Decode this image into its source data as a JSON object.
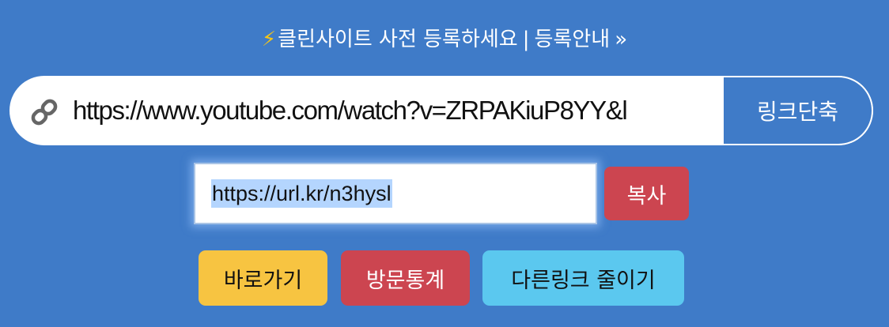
{
  "notice": {
    "bolt": "⚡",
    "main_text": "클린사이트 사전 등록하세요",
    "separator": "|",
    "link_text": "등록안내",
    "raquo": "»"
  },
  "shortener": {
    "input_value": "https://www.youtube.com/watch?v=ZRPAKiuP8YY&l",
    "button_label": "링크단축",
    "icon": "link-icon"
  },
  "result": {
    "short_url": "https://url.kr/n3hysl",
    "copy_label": "복사"
  },
  "actions": {
    "goto_label": "바로가기",
    "stats_label": "방문통계",
    "another_label": "다른링크 줄이기"
  },
  "colors": {
    "background": "#3f7bc8",
    "bolt": "#f5c518",
    "copy_button": "#cc4550",
    "goto_button": "#f7c441",
    "stats_button": "#cc4550",
    "another_button": "#5bc8ef",
    "selection": "#b4d5fe"
  }
}
